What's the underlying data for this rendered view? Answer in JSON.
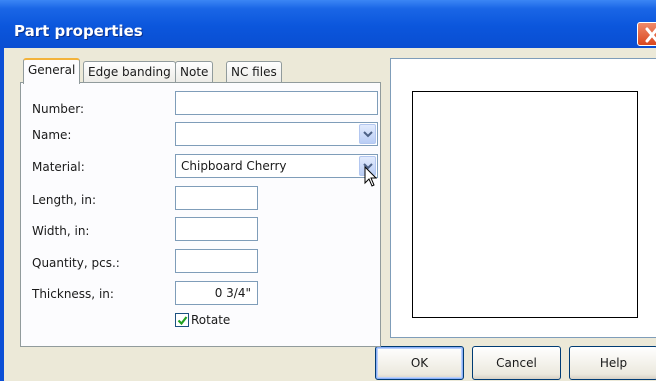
{
  "window": {
    "title": "Part properties"
  },
  "tabs": [
    {
      "label": "General",
      "active": true
    },
    {
      "label": "Edge banding",
      "active": false
    },
    {
      "label": "Note",
      "active": false
    },
    {
      "label": "NC files",
      "active": false
    }
  ],
  "form": {
    "number": {
      "label": "Number:",
      "value": ""
    },
    "name": {
      "label": "Name:",
      "value": ""
    },
    "material": {
      "label": "Material:",
      "value": "Chipboard Cherry"
    },
    "length": {
      "label": "Length, in:",
      "value": ""
    },
    "width": {
      "label": "Width, in:",
      "value": ""
    },
    "quantity": {
      "label": "Quantity, pcs.:",
      "value": ""
    },
    "thickness": {
      "label": "Thickness, in:",
      "value": "0 3/4\""
    },
    "rotate": {
      "label": "Rotate",
      "checked": true
    }
  },
  "buttons": {
    "ok": "OK",
    "cancel": "Cancel",
    "help": "Help"
  },
  "colors": {
    "title_bar": "#0b56dc",
    "close": "#d9471f",
    "dialog_bg": "#ece9d8",
    "tab_highlight": "#f3b33b"
  },
  "icons": {
    "close": "close-icon",
    "dropdown": "chevron-down-icon",
    "check": "check-icon",
    "cursor": "mouse-pointer-icon"
  }
}
